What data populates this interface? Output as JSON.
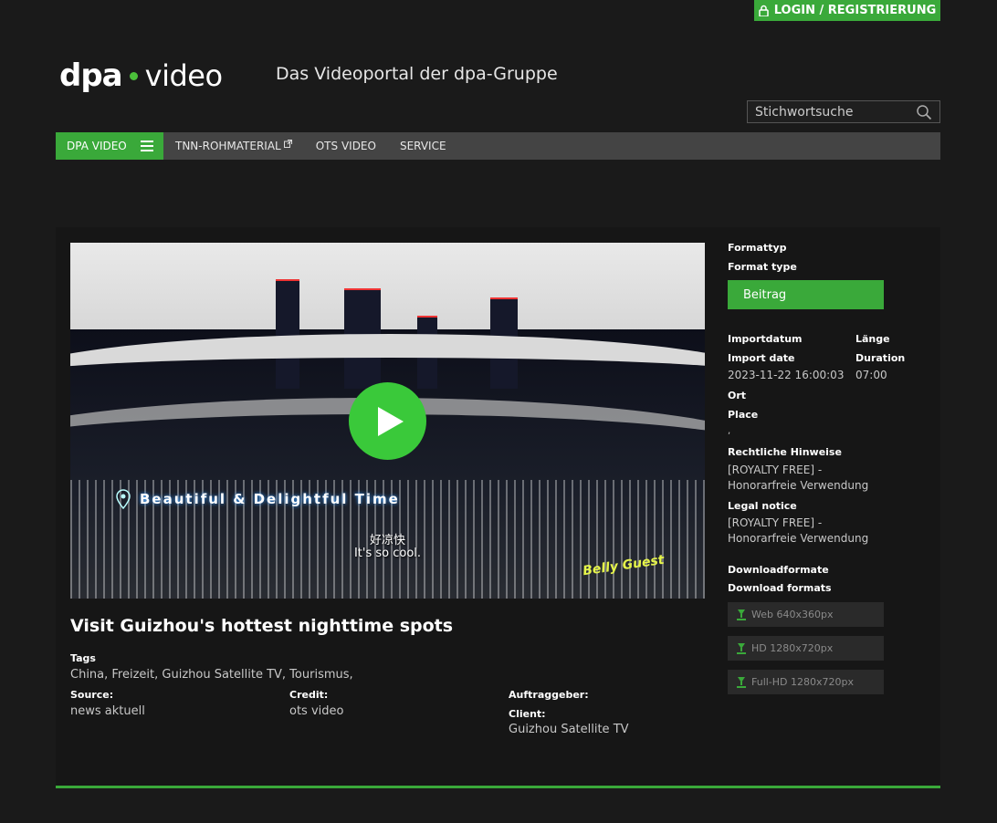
{
  "header": {
    "login_label": "LOGIN / REGISTRIERUNG",
    "logo_left": "dpa",
    "logo_right": "video",
    "tagline": "Das Videoportal der dpa-Gruppe",
    "search_placeholder": "Stichwortsuche"
  },
  "nav": {
    "items": [
      {
        "label": "DPA VIDEO",
        "active": true
      },
      {
        "label": "TNN-ROHMATERIAL",
        "external": true
      },
      {
        "label": "OTS VIDEO"
      },
      {
        "label": "SERVICE"
      }
    ]
  },
  "video": {
    "caption": "Beautiful & Delightful Time",
    "subtitle_zh": "好凉快",
    "subtitle_en": "It's so cool.",
    "badge": "Belly Guest"
  },
  "main": {
    "title": "Visit Guizhou's hottest nighttime spots",
    "tags_label": "Tags",
    "tags_value": "China, Freizeit, Guizhou Satellite TV, Tourismus,",
    "source_label": "Source:",
    "source_value": "news aktuell",
    "credit_label": "Credit:",
    "credit_value": "ots video",
    "auftraggeber_label": "Auftraggeber:",
    "client_label": "Client:",
    "client_value": "Guizhou Satellite TV"
  },
  "sidebar": {
    "formattyp_label": "Formattyp",
    "format_type_label": "Format type",
    "format_value": "Beitrag",
    "importdatum_label": "Importdatum",
    "import_date_label": "Import date",
    "import_date_value": "2023-11-22 16:00:03",
    "laenge_label": "Länge",
    "duration_label": "Duration",
    "duration_value": "07:00",
    "ort_label": "Ort",
    "place_label": "Place",
    "place_value": ",",
    "rechtliche_label": "Rechtliche Hinweise",
    "rechtliche_value": "[ROYALTY FREE] - Honorarfreie Verwendung",
    "legal_label": "Legal notice",
    "legal_value": "[ROYALTY FREE] - Honorarfreie Verwendung",
    "downloadformate_label": "Downloadformate",
    "download_formats_label": "Download formats",
    "downloads": [
      {
        "label": "Web 640x360px"
      },
      {
        "label": "HD 1280x720px"
      },
      {
        "label": "Full-HD 1280x720px"
      }
    ]
  },
  "colors": {
    "accent": "#3aa93a",
    "background": "#1a1a1a",
    "nav": "#444444"
  }
}
